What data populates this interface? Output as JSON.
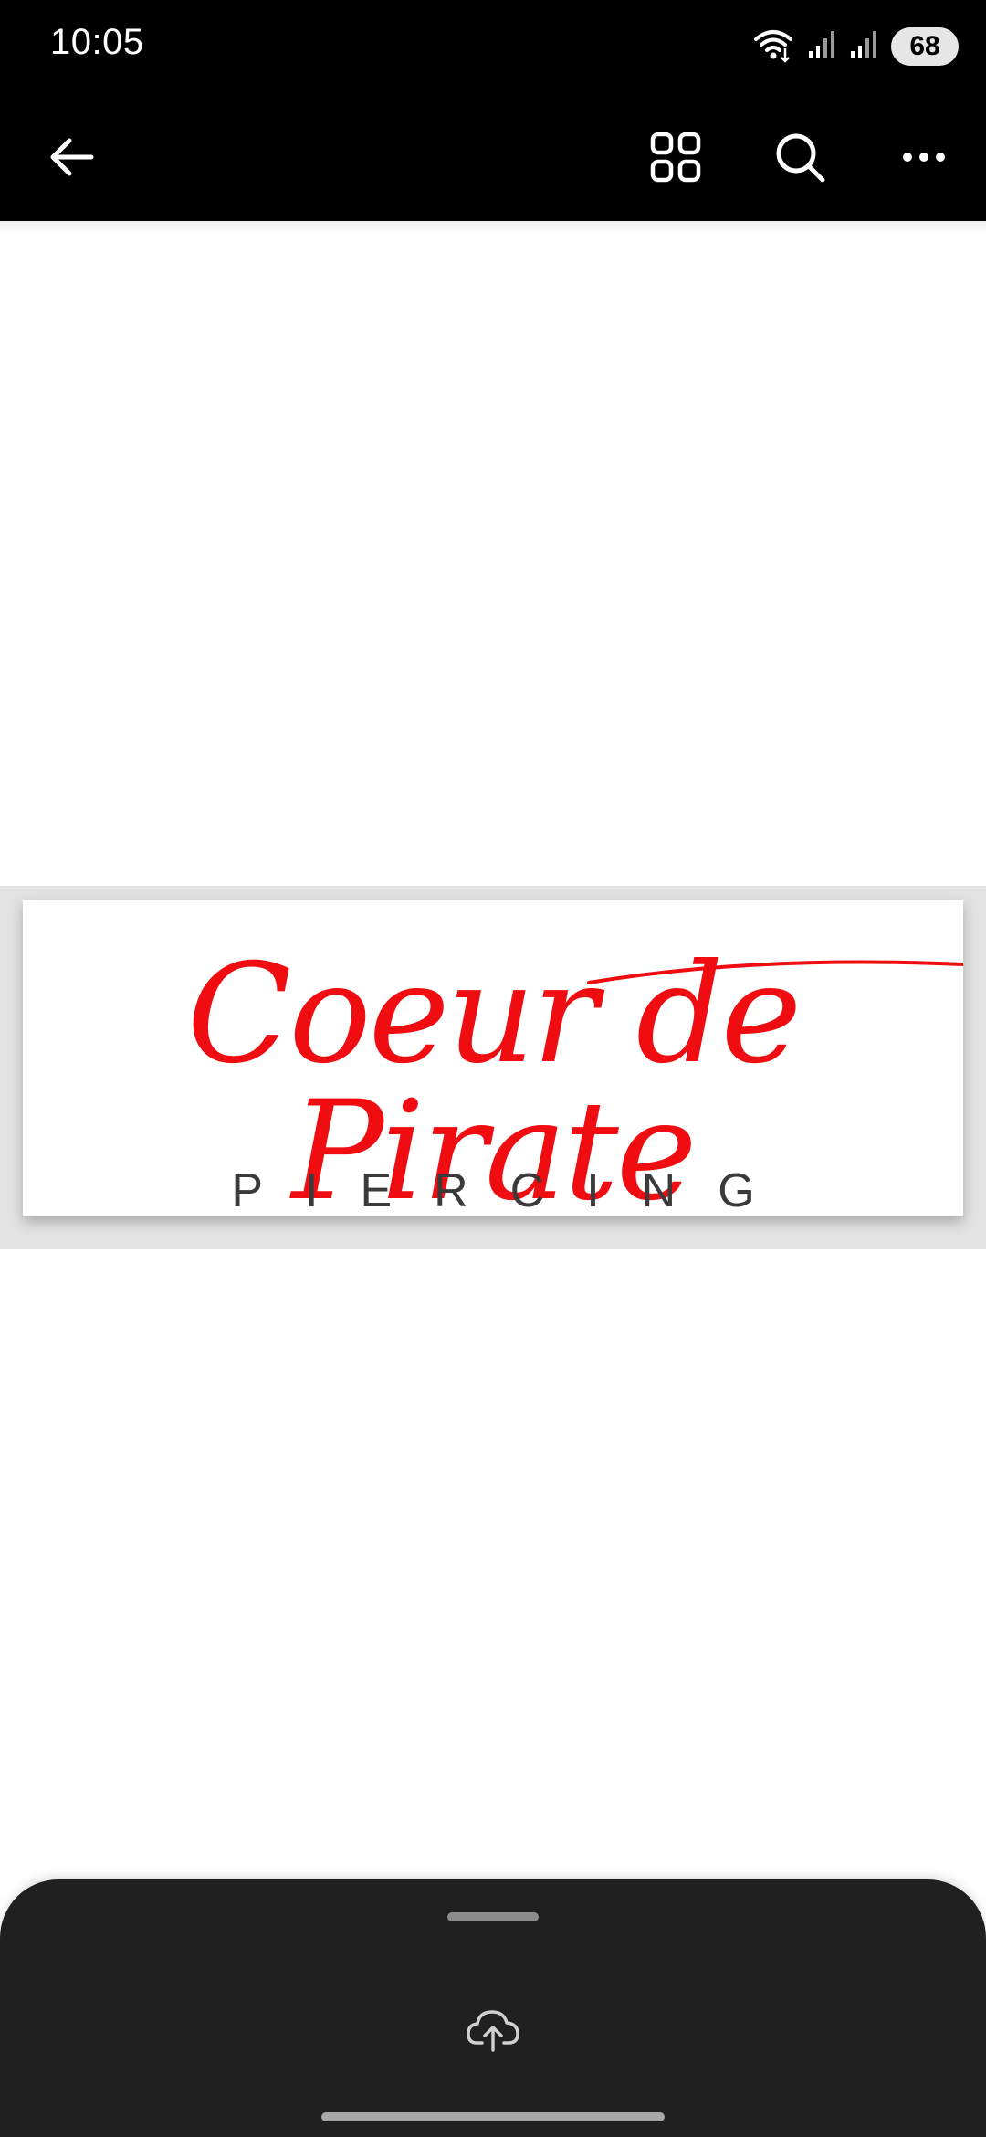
{
  "status_bar": {
    "time": "10:05",
    "battery": "68",
    "icons": [
      "wifi-icon",
      "signal-icon",
      "signal-icon",
      "battery-icon"
    ]
  },
  "app_bar": {
    "icons": [
      "back-arrow-icon",
      "grid-icon",
      "search-icon",
      "more-icon"
    ]
  },
  "image": {
    "logo_title": "Coeur de Pirate",
    "logo_subtitle": "PIERCING"
  },
  "bottom_sheet": {
    "icons": [
      "cloud-upload-icon"
    ]
  },
  "colors": {
    "logo_red": "#ef0d12",
    "bar_black": "#000000",
    "sheet_dark": "#202020"
  }
}
